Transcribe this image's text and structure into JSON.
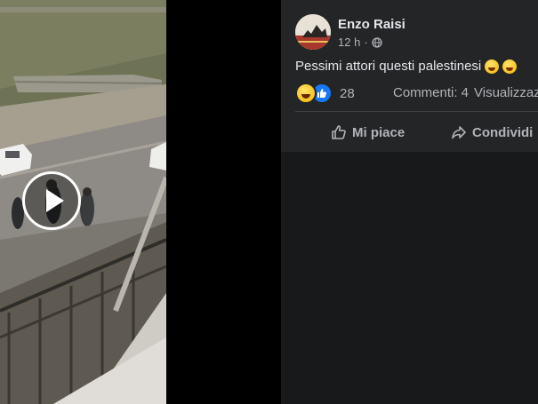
{
  "post": {
    "author": "Enzo Raisi",
    "time": "12 h",
    "privacy_icon": "globe-icon",
    "text": "Pessimi attori questi palestinesi",
    "text_emojis": [
      "laughing-emoji",
      "laughing-emoji"
    ]
  },
  "stats": {
    "reaction_icons": [
      "haha-reaction-icon",
      "like-reaction-icon"
    ],
    "reactions_count": "28",
    "comments": "Commenti: 4",
    "views": "Visualizzazioni"
  },
  "actions": {
    "like_label": "Mi piace",
    "share_label": "Condividi"
  },
  "media": {
    "play_icon": "play-icon"
  },
  "colors": {
    "panel_bg": "#18191a",
    "card_bg": "#242526",
    "primary_text": "#e4e6eb",
    "secondary_text": "#b0b3b8",
    "like_blue": "#1877f2",
    "divider": "#3e4042"
  }
}
